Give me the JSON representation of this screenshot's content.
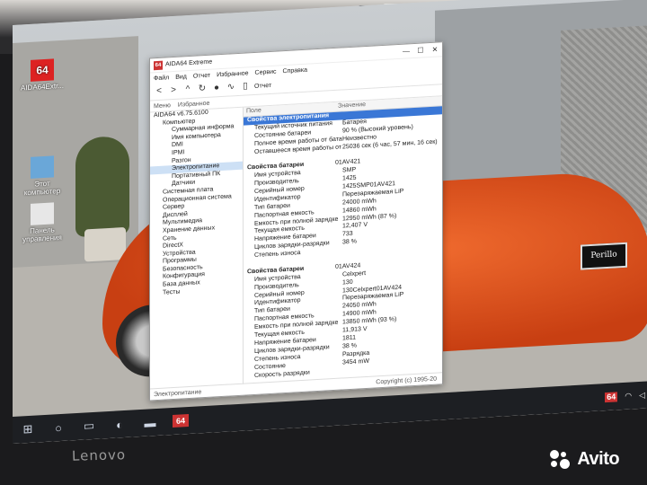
{
  "desktop": {
    "icons": [
      {
        "label": "AIDA64Extr..."
      },
      {
        "label": "Этот компьютер"
      },
      {
        "label": "Панель управления"
      }
    ],
    "plate_text": "Perillo"
  },
  "window": {
    "title": "AIDA64 Extreme",
    "controls": [
      "—",
      "☐",
      "✕"
    ],
    "menu": [
      "Файл",
      "Вид",
      "Отчет",
      "Избранное",
      "Сервис",
      "Справка"
    ],
    "toolbar_report_label": "Отчет",
    "tabs": [
      "Меню",
      "Избранное"
    ],
    "tree": [
      {
        "label": "AIDA64 v6.75.6100",
        "indent": 0
      },
      {
        "label": "Компьютер",
        "indent": 1
      },
      {
        "label": "Суммарная информа",
        "indent": 2
      },
      {
        "label": "Имя компьютера",
        "indent": 2
      },
      {
        "label": "DMI",
        "indent": 2
      },
      {
        "label": "IPMI",
        "indent": 2
      },
      {
        "label": "Разгон",
        "indent": 2
      },
      {
        "label": "Электропитание",
        "indent": 2,
        "selected": true
      },
      {
        "label": "Портативный ПК",
        "indent": 2
      },
      {
        "label": "Датчики",
        "indent": 2
      },
      {
        "label": "Системная плата",
        "indent": 1
      },
      {
        "label": "Операционная система",
        "indent": 1
      },
      {
        "label": "Сервер",
        "indent": 1
      },
      {
        "label": "Дисплей",
        "indent": 1
      },
      {
        "label": "Мультимедиа",
        "indent": 1
      },
      {
        "label": "Хранение данных",
        "indent": 1
      },
      {
        "label": "Сеть",
        "indent": 1
      },
      {
        "label": "DirectX",
        "indent": 1
      },
      {
        "label": "Устройства",
        "indent": 1
      },
      {
        "label": "Программы",
        "indent": 1
      },
      {
        "label": "Безопасность",
        "indent": 1
      },
      {
        "label": "Конфигурация",
        "indent": 1
      },
      {
        "label": "База данных",
        "indent": 1
      },
      {
        "label": "Тесты",
        "indent": 1
      }
    ],
    "columns": [
      "Поле",
      "Значение"
    ],
    "rows": [
      {
        "field": "Свойства электропитания",
        "value": "",
        "header": true,
        "selected": true
      },
      {
        "field": "Текущий источник питания",
        "value": "Батарея"
      },
      {
        "field": "Состояние батареи",
        "value": "90 % (Высокий уровень)"
      },
      {
        "field": "Полное время работы от бата...",
        "value": "Неизвестно"
      },
      {
        "field": "Оставшееся время работы от ...",
        "value": "25036 сек (6 час, 57 мин, 16 сек)"
      },
      {
        "field": "",
        "value": ""
      },
      {
        "field": "Свойства батареи",
        "value": "01AV421",
        "header": true
      },
      {
        "field": "Имя устройства",
        "value": "SMP"
      },
      {
        "field": "Производитель",
        "value": "1425"
      },
      {
        "field": "Серийный номер",
        "value": "1425SMP01AV421"
      },
      {
        "field": "Идентификатор",
        "value": "Перезаряжаемая LiP"
      },
      {
        "field": "Тип батареи",
        "value": "24000 mWh"
      },
      {
        "field": "Паспортная емкость",
        "value": "14860 mWh"
      },
      {
        "field": "Емкость при полной зарядке",
        "value": "12950 mWh (87 %)"
      },
      {
        "field": "Текущая емкость",
        "value": "12,407 V"
      },
      {
        "field": "Напряжение батареи",
        "value": "733"
      },
      {
        "field": "Циклов зарядки-разрядки",
        "value": "38 %"
      },
      {
        "field": "Степень износа",
        "value": ""
      },
      {
        "field": "",
        "value": ""
      },
      {
        "field": "Свойства батареи",
        "value": "01AV424",
        "header": true
      },
      {
        "field": "Имя устройства",
        "value": "Celxpert"
      },
      {
        "field": "Производитель",
        "value": "130"
      },
      {
        "field": "Серийный номер",
        "value": "130Celxpert01AV424"
      },
      {
        "field": "Идентификатор",
        "value": "Перезаряжаемая LiP"
      },
      {
        "field": "Тип батареи",
        "value": "24050 mWh"
      },
      {
        "field": "Паспортная емкость",
        "value": "14900 mWh"
      },
      {
        "field": "Емкость при полной зарядке",
        "value": "13850 mWh (93 %)"
      },
      {
        "field": "Текущая емкость",
        "value": "11,913 V"
      },
      {
        "field": "Напряжение батареи",
        "value": "1811"
      },
      {
        "field": "Циклов зарядки-разрядки",
        "value": "38 %"
      },
      {
        "field": "Степень износа",
        "value": "Разрядка"
      },
      {
        "field": "Состояние",
        "value": "3454 mW"
      },
      {
        "field": "Скорость разрядки",
        "value": ""
      }
    ],
    "status_left": "Электропитание",
    "status_right": "Copyright (c) 1995-20"
  },
  "taskbar": {
    "start_icon": "windows-logo-icon",
    "aida_label": "64",
    "tray_badge": "64"
  },
  "laptop": {
    "brand": "Lenovo",
    "watermark": "Avito"
  }
}
